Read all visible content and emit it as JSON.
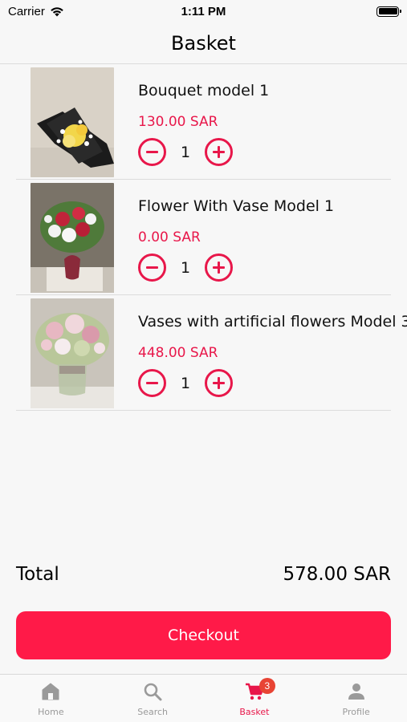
{
  "status_bar": {
    "carrier": "Carrier",
    "time": "1:11 PM"
  },
  "nav": {
    "title": "Basket"
  },
  "currency_color": "#e8174a",
  "items": [
    {
      "name": "Bouquet model 1",
      "price": "130.00 SAR",
      "quantity": "1",
      "image_icon": "bouquet-photo"
    },
    {
      "name": "Flower With Vase Model 1",
      "price": "0.00 SAR",
      "quantity": "1",
      "image_icon": "flower-vase-photo"
    },
    {
      "name": "Vases with artificial flowers Model 3",
      "price": "448.00 SAR",
      "quantity": "1",
      "image_icon": "artificial-flowers-vase-photo"
    }
  ],
  "total": {
    "label": "Total",
    "value": "578.00 SAR"
  },
  "checkout": {
    "label": "Checkout",
    "color": "#ff1a48"
  },
  "tabs": [
    {
      "label": "Home",
      "icon": "home-icon",
      "active": false
    },
    {
      "label": "Search",
      "icon": "search-icon",
      "active": false
    },
    {
      "label": "Basket",
      "icon": "cart-icon",
      "active": true,
      "badge": "3"
    },
    {
      "label": "Profile",
      "icon": "person-icon",
      "active": false
    }
  ]
}
